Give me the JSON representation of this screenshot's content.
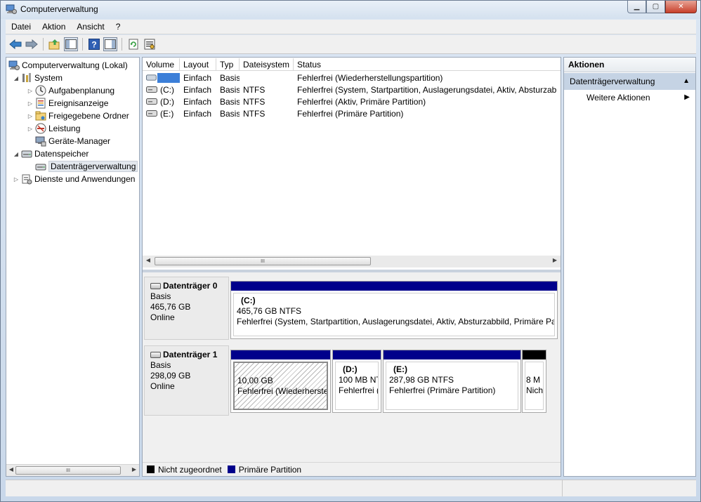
{
  "window": {
    "title": "Computerverwaltung"
  },
  "menu": [
    "Datei",
    "Aktion",
    "Ansicht",
    "?"
  ],
  "tree": {
    "root": "Computerverwaltung (Lokal)",
    "system": "System",
    "aufgabenplanung": "Aufgabenplanung",
    "ereignisanzeige": "Ereignisanzeige",
    "freigegebene_ordner": "Freigegebene Ordner",
    "leistung": "Leistung",
    "geraete_manager": "Geräte-Manager",
    "datenspeicher": "Datenspeicher",
    "datentraegerverwaltung": "Datenträgerverwaltung",
    "dienste": "Dienste und Anwendungen"
  },
  "volumes": {
    "headers": [
      "Volume",
      "Layout",
      "Typ",
      "Dateisystem",
      "Status"
    ],
    "rows": [
      {
        "volume": "",
        "layout": "Einfach",
        "typ": "Basis",
        "fs": "",
        "status": "Fehlerfrei (Wiederherstellungspartition)"
      },
      {
        "volume": "(C:)",
        "layout": "Einfach",
        "typ": "Basis",
        "fs": "NTFS",
        "status": "Fehlerfrei (System, Startpartition, Auslagerungsdatei, Aktiv, Absturzabbi"
      },
      {
        "volume": "(D:)",
        "layout": "Einfach",
        "typ": "Basis",
        "fs": "NTFS",
        "status": "Fehlerfrei (Aktiv, Primäre Partition)"
      },
      {
        "volume": "(E:)",
        "layout": "Einfach",
        "typ": "Basis",
        "fs": "NTFS",
        "status": "Fehlerfrei (Primäre Partition)"
      }
    ]
  },
  "disks": [
    {
      "name": "Datenträger 0",
      "type": "Basis",
      "size": "465,76 GB",
      "state": "Online",
      "partitions": [
        {
          "name": "(C:)",
          "size": "465,76 GB NTFS",
          "status": "Fehlerfrei (System, Startpartition, Auslagerungsdatei, Aktiv, Absturzabbild, Primäre Par"
        }
      ]
    },
    {
      "name": "Datenträger 1",
      "type": "Basis",
      "size": "298,09 GB",
      "state": "Online",
      "partitions": [
        {
          "name": "",
          "size": "10,00 GB",
          "status": "Fehlerfrei (Wiederherstel"
        },
        {
          "name": "(D:)",
          "size": "100 MB NT",
          "status": "Fehlerfrei ("
        },
        {
          "name": "(E:)",
          "size": "287,98 GB NTFS",
          "status": "Fehlerfrei (Primäre Partition)"
        },
        {
          "name": "",
          "size": "8 M",
          "status": "Nich"
        }
      ]
    }
  ],
  "legend": {
    "unallocated": "Nicht zugeordnet",
    "primary": "Primäre Partition"
  },
  "actions": {
    "header": "Aktionen",
    "section": "Datenträgerverwaltung",
    "more": "Weitere Aktionen"
  },
  "scroll_thumb": "III",
  "colors": {
    "primary_partition": "#00008b",
    "unallocated": "#000000",
    "selection": "#c5d3e4"
  }
}
